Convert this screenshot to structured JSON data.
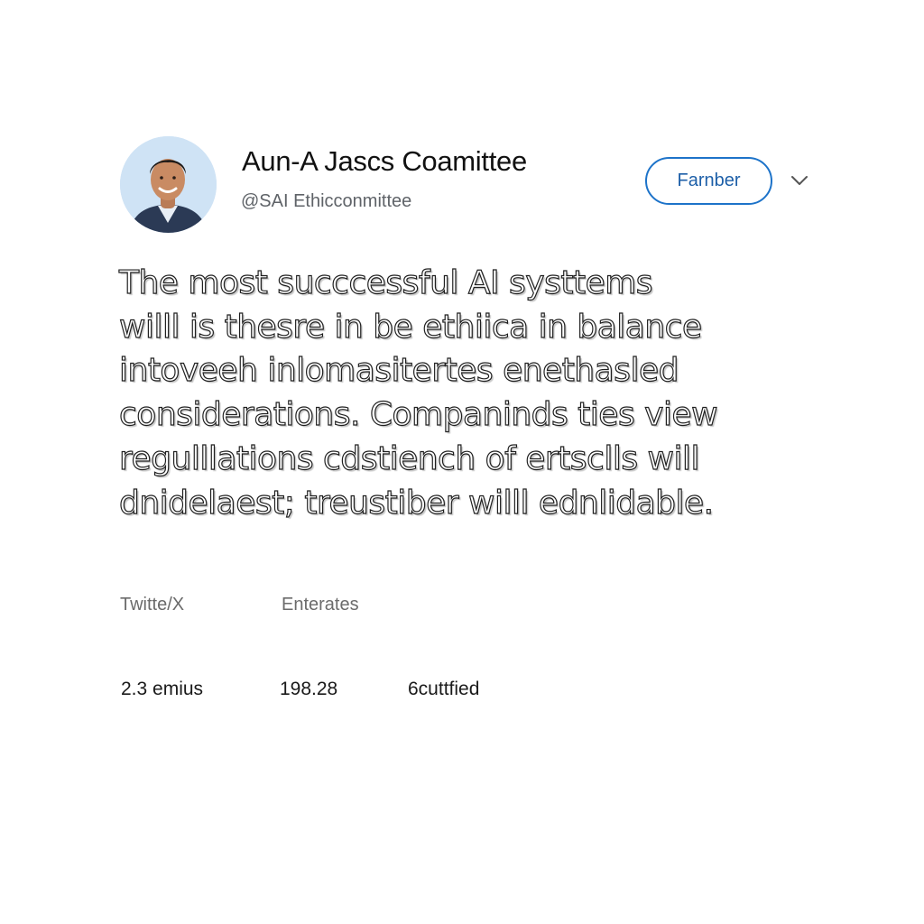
{
  "profile": {
    "display_name": "Aun-A Jascs Coamittee",
    "handle": "@SAI Ethicconmittee",
    "avatar_icon": "person-portrait-icon"
  },
  "actions": {
    "follow_label": "Farnber",
    "menu_icon": "chevron-down-icon"
  },
  "post": {
    "lines": [
      "The most succcessful AI systtems",
      "willl is thesre in be ethiica in balance",
      "intoveeh inlomasitertes enethasled",
      "considerations. Companinds ties view",
      "regulllations cdstiench of ertsclls will",
      "dnidelaest; treustiber willl ednlidable."
    ]
  },
  "meta": {
    "source_label": "Twitte/X",
    "engagement_label": "Enterates"
  },
  "stats": {
    "views": "2.3 emius",
    "count": "198.28",
    "third": "6cuttfied"
  },
  "colors": {
    "accent": "#1d73c9",
    "text_primary": "#111111",
    "text_secondary": "#5f6368"
  }
}
